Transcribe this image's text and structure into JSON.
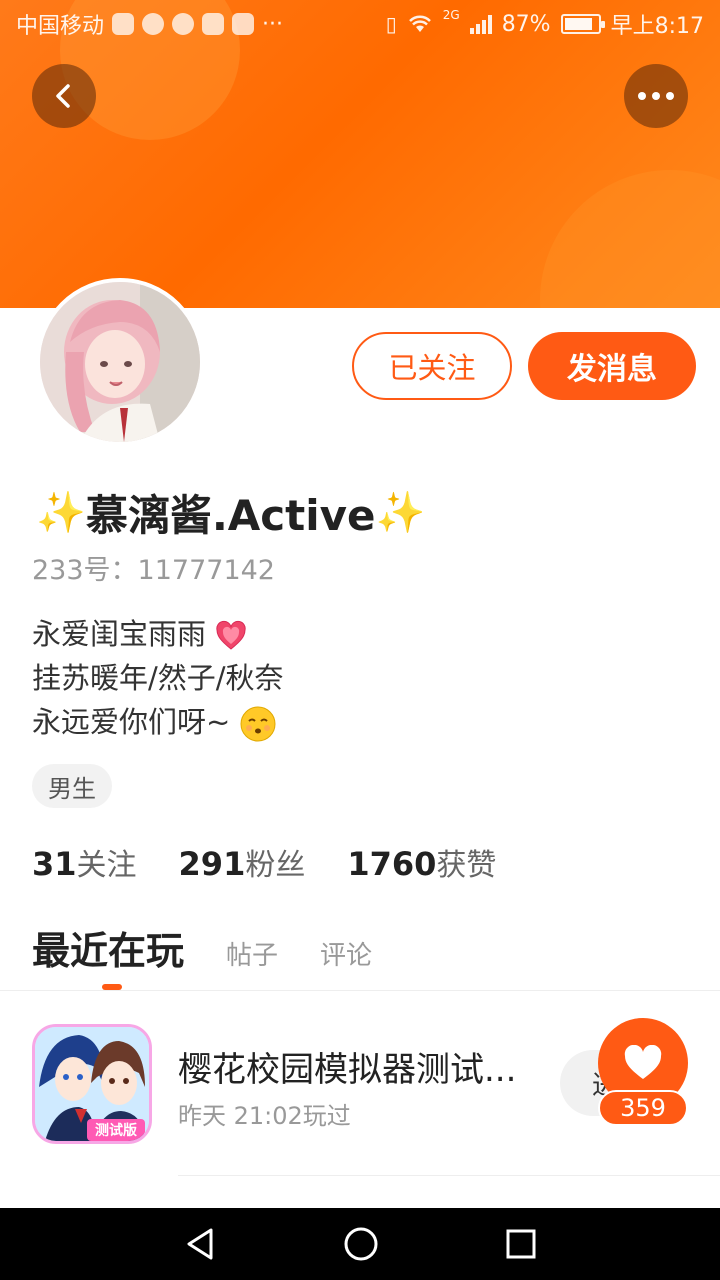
{
  "status_bar": {
    "carrier": "中国移动",
    "battery_percent": "87%",
    "time": "早上8:17",
    "battery_level": 0.87,
    "network": "2G",
    "overflow": "···"
  },
  "header": {
    "back_icon": "chevron-left-icon",
    "more_icon": "more-horizontal-icon"
  },
  "profile": {
    "follow_state_label": "已关注",
    "message_label": "发消息",
    "name": "慕漓酱.Active",
    "id_label": "233号：",
    "id_value": "11777142",
    "bio_lines": [
      "永爱闺宝雨雨",
      "挂苏暖年/然子/秋奈",
      "永远爱你们呀~"
    ],
    "gender": "男生",
    "decor_left": "✨",
    "decor_right": "✨"
  },
  "stats": [
    {
      "value": "31",
      "label": "关注"
    },
    {
      "value": "291",
      "label": "粉丝"
    },
    {
      "value": "1760",
      "label": "获赞"
    }
  ],
  "tabs": [
    {
      "label": "最近在玩",
      "active": true
    },
    {
      "label": "帖子",
      "active": false
    },
    {
      "label": "评论",
      "active": false
    }
  ],
  "games": [
    {
      "title": "樱花校园模拟器测试...",
      "subtitle": "昨天 21:02玩过",
      "icon_badge": "测试版",
      "action_label": "进"
    }
  ],
  "like": {
    "count": "359"
  },
  "colors": {
    "accent": "#ff5a14",
    "header": "#ff7a1a"
  }
}
